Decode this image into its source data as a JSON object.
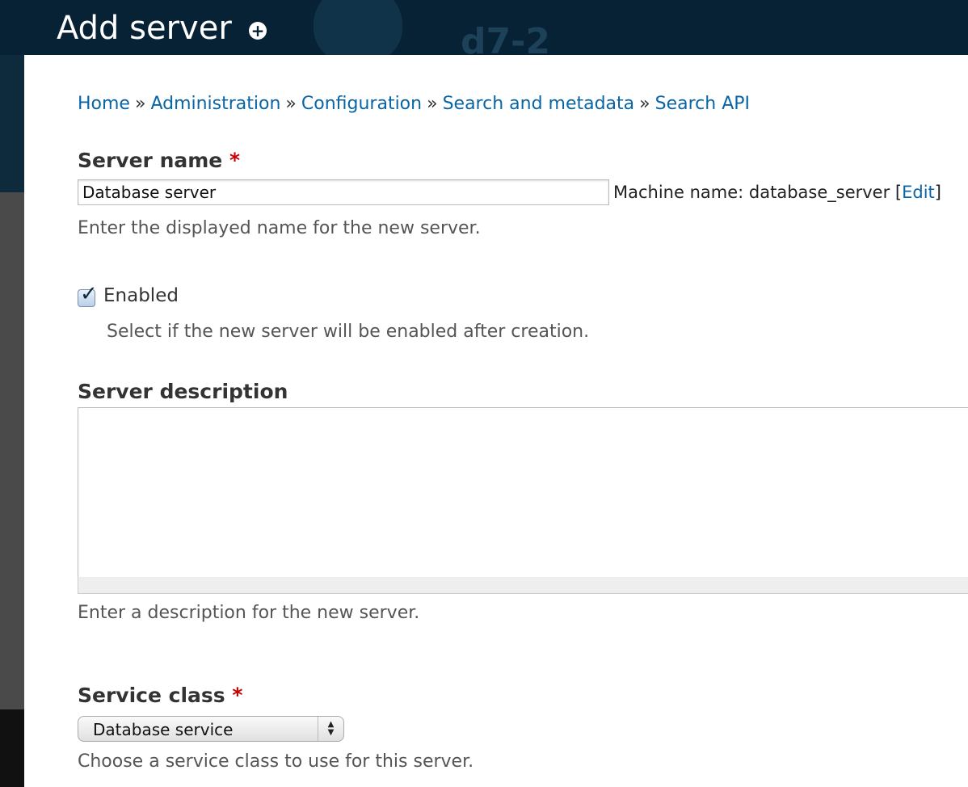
{
  "header": {
    "page_title": "Add server",
    "site_name": "d7-2"
  },
  "breadcrumb": [
    "Home",
    "Administration",
    "Configuration",
    "Search and metadata",
    "Search API"
  ],
  "breadcrumb_separator": "»",
  "form": {
    "server_name": {
      "label": "Server name",
      "required_marker": "*",
      "value": "Database server",
      "machine_name_prefix": "Machine name: database_server [",
      "machine_name_edit": "Edit",
      "machine_name_suffix": "]",
      "description": "Enter the displayed name for the new server."
    },
    "enabled": {
      "label": "Enabled",
      "checked": true,
      "description": "Select if the new server will be enabled after creation."
    },
    "server_description": {
      "label": "Server description",
      "value": "",
      "description": "Enter a description for the new server."
    },
    "service_class": {
      "label": "Service class",
      "required_marker": "*",
      "selected": "Database service",
      "description": "Choose a service class to use for this server."
    }
  }
}
